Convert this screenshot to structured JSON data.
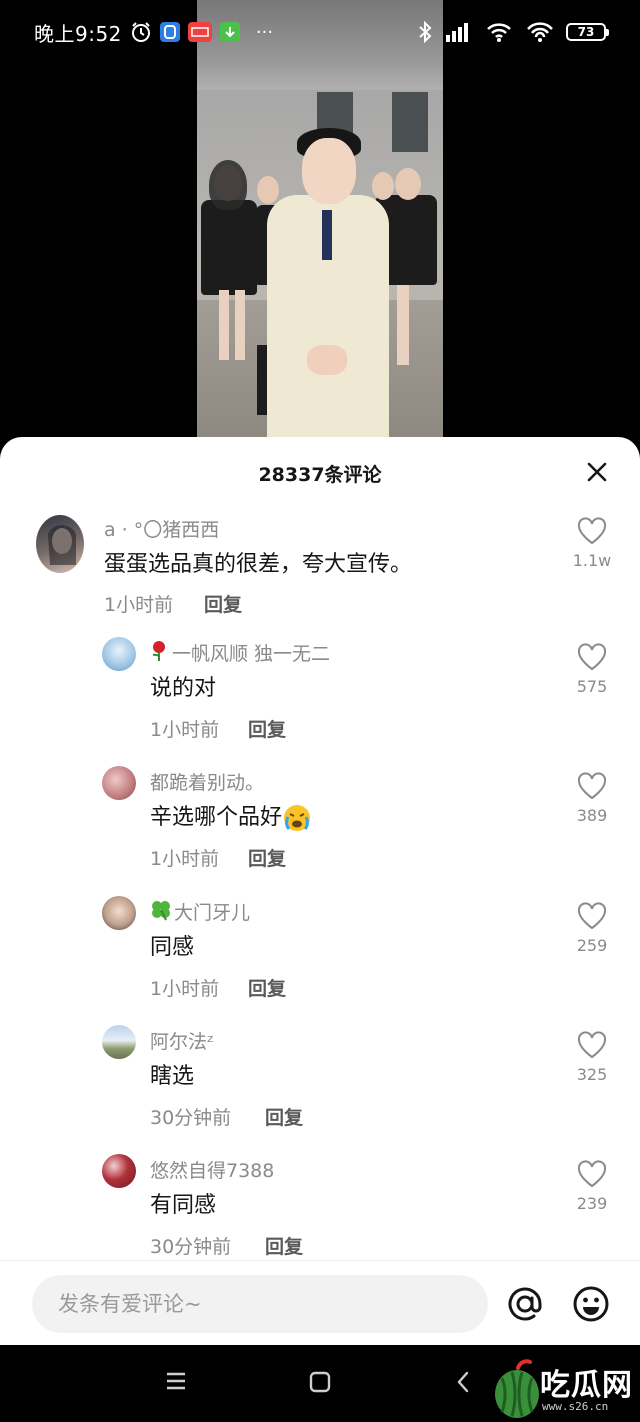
{
  "status_bar": {
    "time": "晚上9:52",
    "battery": "73",
    "app_badges": [
      "toutiao",
      "download"
    ],
    "more": "···"
  },
  "video": {
    "description_icon": "video-player"
  },
  "comments_sheet": {
    "title": "28337条评论",
    "close_icon": "close-icon",
    "comments": [
      {
        "name": "a · °〇猪西西",
        "text": "蛋蛋选品真的很差，夸大宣传。",
        "time": "1小时前",
        "reply": "回复",
        "likes": "1.1w"
      },
      {
        "name": "一帆风顺  独一无二",
        "name_prefix_icon": "rose-icon",
        "text": "说的对",
        "time": "1小时前",
        "reply": "回复",
        "likes": "575"
      },
      {
        "name": "都跪着别动。",
        "text": "辛选哪个品好",
        "text_emoji": "crying-emoji",
        "time": "1小时前",
        "reply": "回复",
        "likes": "389"
      },
      {
        "name": "大门牙儿",
        "name_prefix_icon": "clover-icon",
        "text": "同感",
        "time": "1小时前",
        "reply": "回复",
        "likes": "259"
      },
      {
        "name": "阿尔法ᶻ",
        "text": "瞎选",
        "time": "30分钟前",
        "reply": "回复",
        "likes": "325"
      },
      {
        "name": "悠然自得7388",
        "text": "有同感",
        "time": "30分钟前",
        "reply": "回复",
        "likes": "239"
      }
    ]
  },
  "input_bar": {
    "placeholder": "发条有爱评论~",
    "at_icon": "at-icon",
    "emoji_icon": "smile-icon"
  },
  "nav_bar": {
    "menu": "menu-icon",
    "home": "home-icon",
    "back": "back-icon"
  },
  "watermark": {
    "text": "吃瓜网",
    "url": "www.s26.cn"
  },
  "colors": {
    "accent_like": "#8a8a8a",
    "background": "#ffffff"
  }
}
